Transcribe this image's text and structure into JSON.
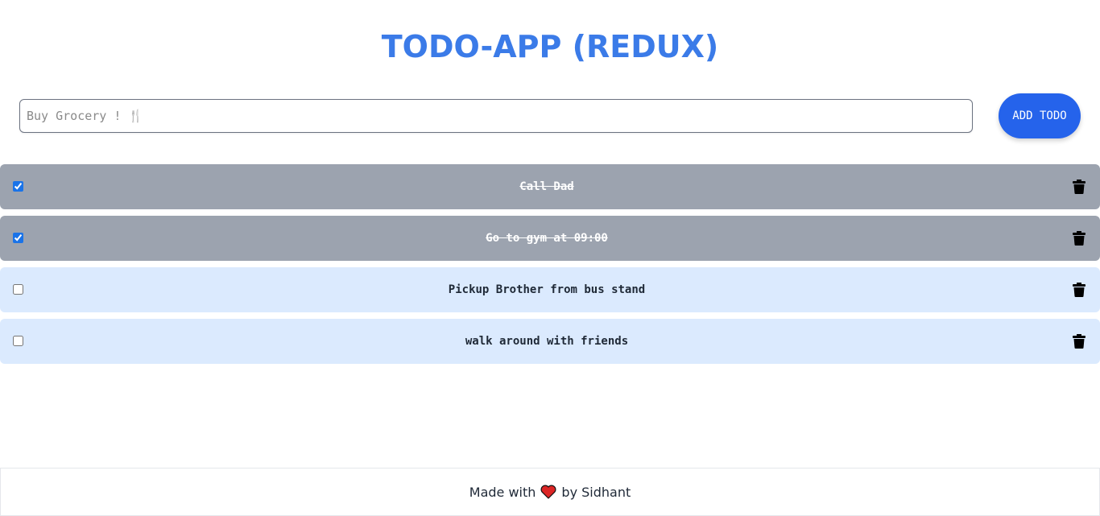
{
  "app": {
    "title": "TODO-APP (REDUX)"
  },
  "add_todo": {
    "placeholder": "Buy Grocery ! 🍴",
    "button_label": "ADD TODO"
  },
  "todos": [
    {
      "text": "Call Dad",
      "completed": true
    },
    {
      "text": "Go to gym at 09:00",
      "completed": true
    },
    {
      "text": "Pickup Brother from bus stand",
      "completed": false
    },
    {
      "text": "walk around with friends",
      "completed": false
    }
  ],
  "footer": {
    "prefix": "Made with",
    "suffix": "by Sidhant",
    "icon": "heart-icon"
  },
  "colors": {
    "accent": "#3b7be8",
    "button": "#2563eb",
    "done_row": "#9ca3af",
    "open_row": "#dbeafe"
  }
}
